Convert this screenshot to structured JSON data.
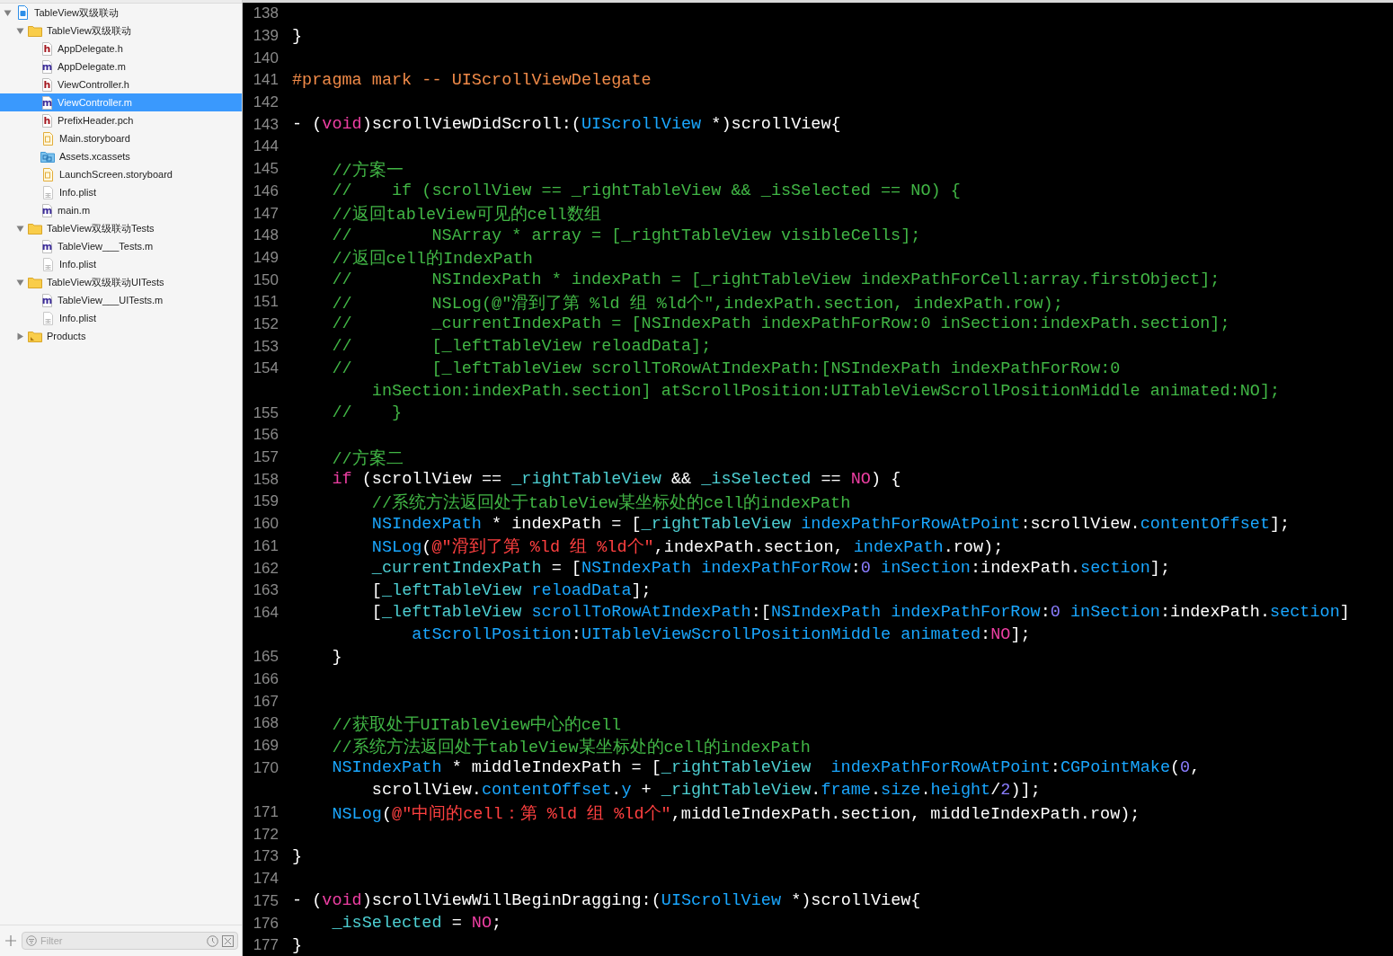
{
  "navigator": {
    "items": [
      {
        "label": "TableView双级联动",
        "kind": "project",
        "expanded": true,
        "selected": false,
        "children": [
          {
            "label": "TableView双级联动",
            "kind": "folder",
            "expanded": true,
            "selected": false,
            "children": [
              {
                "label": "AppDelegate.h",
                "kind": "source",
                "icon_letter": "h",
                "selected": false
              },
              {
                "label": "AppDelegate.m",
                "kind": "source",
                "icon_letter": "m",
                "selected": false
              },
              {
                "label": "ViewController.h",
                "kind": "source",
                "icon_letter": "h",
                "selected": false
              },
              {
                "label": "ViewController.m",
                "kind": "source",
                "icon_letter": "m",
                "selected": true
              },
              {
                "label": "PrefixHeader.pch",
                "kind": "source",
                "icon_letter": "h",
                "selected": false
              },
              {
                "label": "Main.storyboard",
                "kind": "storyboard",
                "selected": false
              },
              {
                "label": "Assets.xcassets",
                "kind": "assets",
                "selected": false
              },
              {
                "label": "LaunchScreen.storyboard",
                "kind": "storyboard",
                "selected": false
              },
              {
                "label": "Info.plist",
                "kind": "plist",
                "selected": false
              },
              {
                "label": "main.m",
                "kind": "source",
                "icon_letter": "m",
                "selected": false
              }
            ]
          },
          {
            "label": "TableView双级联动Tests",
            "kind": "folder",
            "expanded": true,
            "selected": false,
            "children": [
              {
                "label": "TableView___Tests.m",
                "kind": "source",
                "icon_letter": "m",
                "selected": false
              },
              {
                "label": "Info.plist",
                "kind": "plist",
                "selected": false
              }
            ]
          },
          {
            "label": "TableView双级联动UITests",
            "kind": "folder",
            "expanded": true,
            "selected": false,
            "children": [
              {
                "label": "TableView___UITests.m",
                "kind": "source",
                "icon_letter": "m",
                "selected": false
              },
              {
                "label": "Info.plist",
                "kind": "plist",
                "selected": false
              }
            ]
          },
          {
            "label": "Products",
            "kind": "products",
            "expanded": false,
            "selected": false
          }
        ]
      }
    ],
    "filter": {
      "placeholder": "Filter"
    }
  },
  "editor": {
    "lines": [
      {
        "number": "138"
      },
      {
        "number": "139",
        "tokens": [
          {
            "kind": "plain",
            "text": "}"
          }
        ]
      },
      {
        "number": "140"
      },
      {
        "number": "141",
        "tokens": [
          {
            "kind": "preproc",
            "text": "#pragma mark -- UIScrollViewDelegate"
          }
        ]
      },
      {
        "number": "142"
      },
      {
        "number": "143",
        "tokens": [
          {
            "kind": "plain",
            "text": "- ("
          },
          {
            "kind": "keyword",
            "text": "void"
          },
          {
            "kind": "plain",
            "text": ")scrollViewDidScroll:("
          },
          {
            "kind": "type",
            "text": "UIScrollView"
          },
          {
            "kind": "plain",
            "text": " *)scrollView{"
          }
        ]
      },
      {
        "number": "144"
      },
      {
        "number": "145",
        "tokens": [
          {
            "kind": "comment",
            "text": "    //方案一"
          }
        ]
      },
      {
        "number": "146",
        "tokens": [
          {
            "kind": "comment",
            "text": "    //    if (scrollView == _rightTableView && _isSelected == NO) {"
          }
        ]
      },
      {
        "number": "147",
        "tokens": [
          {
            "kind": "comment",
            "text": "    //返回tableView可见的cell数组"
          }
        ]
      },
      {
        "number": "148",
        "tokens": [
          {
            "kind": "comment",
            "text": "    //        NSArray * array = [_rightTableView visibleCells];"
          }
        ]
      },
      {
        "number": "149",
        "tokens": [
          {
            "kind": "comment",
            "text": "    //返回cell的IndexPath"
          }
        ]
      },
      {
        "number": "150",
        "tokens": [
          {
            "kind": "comment",
            "text": "    //        NSIndexPath * indexPath = [_rightTableView indexPathForCell:array.firstObject];"
          }
        ]
      },
      {
        "number": "151",
        "tokens": [
          {
            "kind": "comment",
            "text": "    //        NSLog(@\"滑到了第 %ld 组 %ld个\",indexPath.section, indexPath.row);"
          }
        ]
      },
      {
        "number": "152",
        "tokens": [
          {
            "kind": "comment",
            "text": "    //        _currentIndexPath = [NSIndexPath indexPathForRow:0 inSection:indexPath.section];"
          }
        ]
      },
      {
        "number": "153",
        "tokens": [
          {
            "kind": "comment",
            "text": "    //        [_leftTableView reloadData];"
          }
        ]
      },
      {
        "number": "154",
        "tokens": [
          {
            "kind": "comment",
            "text": "    //        [_leftTableView scrollToRowAtIndexPath:[NSIndexPath indexPathForRow:0"
          }
        ],
        "wrapped_tokens": [
          {
            "kind": "comment",
            "text": "        inSection:indexPath.section] atScrollPosition:UITableViewScrollPositionMiddle animated:NO];"
          }
        ]
      },
      {
        "number": "155",
        "tokens": [
          {
            "kind": "comment",
            "text": "    //    }"
          }
        ]
      },
      {
        "number": "156"
      },
      {
        "number": "157",
        "tokens": [
          {
            "kind": "comment",
            "text": "    //方案二"
          }
        ]
      },
      {
        "number": "158",
        "tokens": [
          {
            "kind": "keyword",
            "text": "    if"
          },
          {
            "kind": "plain",
            "text": " (scrollView == "
          },
          {
            "kind": "ivar",
            "text": "_rightTableView"
          },
          {
            "kind": "plain",
            "text": " && "
          },
          {
            "kind": "ivar",
            "text": "_isSelected"
          },
          {
            "kind": "plain",
            "text": " == "
          },
          {
            "kind": "keyword",
            "text": "NO"
          },
          {
            "kind": "plain",
            "text": ") {"
          }
        ]
      },
      {
        "number": "159",
        "tokens": [
          {
            "kind": "comment",
            "text": "        //系统方法返回处于tableView某坐标处的cell的indexPath"
          }
        ]
      },
      {
        "number": "160",
        "tokens": [
          {
            "kind": "type",
            "text": "        NSIndexPath"
          },
          {
            "kind": "plain",
            "text": " * indexPath = ["
          },
          {
            "kind": "ivar",
            "text": "_rightTableView"
          },
          {
            "kind": "method",
            "text": " indexPathForRowAtPoint"
          },
          {
            "kind": "plain",
            "text": ":scrollView."
          },
          {
            "kind": "method",
            "text": "contentOffset"
          },
          {
            "kind": "plain",
            "text": "];"
          }
        ]
      },
      {
        "number": "161",
        "tokens": [
          {
            "kind": "type",
            "text": "        NSLog"
          },
          {
            "kind": "plain",
            "text": "("
          },
          {
            "kind": "string",
            "text": "@\"滑到了第 %ld 组 %ld个\""
          },
          {
            "kind": "plain",
            "text": ",indexPath.section, "
          },
          {
            "kind": "method",
            "text": "indexPath"
          },
          {
            "kind": "plain",
            "text": ".row);"
          }
        ]
      },
      {
        "number": "162",
        "tokens": [
          {
            "kind": "ivar",
            "text": "        _currentIndexPath"
          },
          {
            "kind": "plain",
            "text": " = ["
          },
          {
            "kind": "type",
            "text": "NSIndexPath"
          },
          {
            "kind": "method",
            "text": " indexPathForRow"
          },
          {
            "kind": "plain",
            "text": ":"
          },
          {
            "kind": "number",
            "text": "0"
          },
          {
            "kind": "method",
            "text": " inSection"
          },
          {
            "kind": "plain",
            "text": ":indexPath."
          },
          {
            "kind": "method",
            "text": "section"
          },
          {
            "kind": "plain",
            "text": "];"
          }
        ]
      },
      {
        "number": "163",
        "tokens": [
          {
            "kind": "plain",
            "text": "        ["
          },
          {
            "kind": "ivar",
            "text": "_leftTableView"
          },
          {
            "kind": "method",
            "text": " reloadData"
          },
          {
            "kind": "plain",
            "text": "];"
          }
        ]
      },
      {
        "number": "164",
        "tokens": [
          {
            "kind": "plain",
            "text": "        ["
          },
          {
            "kind": "ivar",
            "text": "_leftTableView"
          },
          {
            "kind": "method",
            "text": " scrollToRowAtIndexPath"
          },
          {
            "kind": "plain",
            "text": ":["
          },
          {
            "kind": "type",
            "text": "NSIndexPath"
          },
          {
            "kind": "method",
            "text": " indexPathForRow"
          },
          {
            "kind": "plain",
            "text": ":"
          },
          {
            "kind": "number",
            "text": "0"
          },
          {
            "kind": "method",
            "text": " inSection"
          },
          {
            "kind": "plain",
            "text": ":indexPath."
          },
          {
            "kind": "method",
            "text": "section"
          },
          {
            "kind": "plain",
            "text": "]"
          }
        ],
        "wrapped_tokens": [
          {
            "kind": "method",
            "text": "            atScrollPosition"
          },
          {
            "kind": "plain",
            "text": ":"
          },
          {
            "kind": "type",
            "text": "UITableViewScrollPositionMiddle"
          },
          {
            "kind": "method",
            "text": " animated"
          },
          {
            "kind": "plain",
            "text": ":"
          },
          {
            "kind": "keyword",
            "text": "NO"
          },
          {
            "kind": "plain",
            "text": "];"
          }
        ]
      },
      {
        "number": "165",
        "tokens": [
          {
            "kind": "plain",
            "text": "    }"
          }
        ]
      },
      {
        "number": "166"
      },
      {
        "number": "167"
      },
      {
        "number": "168",
        "tokens": [
          {
            "kind": "comment",
            "text": "    //获取处于UITableView中心的cell"
          }
        ]
      },
      {
        "number": "169",
        "tokens": [
          {
            "kind": "comment",
            "text": "    //系统方法返回处于tableView某坐标处的cell的indexPath"
          }
        ]
      },
      {
        "number": "170",
        "tokens": [
          {
            "kind": "type",
            "text": "    NSIndexPath"
          },
          {
            "kind": "plain",
            "text": " * middleIndexPath = ["
          },
          {
            "kind": "ivar",
            "text": "_rightTableView"
          },
          {
            "kind": "method",
            "text": "  indexPathForRowAtPoint"
          },
          {
            "kind": "plain",
            "text": ":"
          },
          {
            "kind": "type",
            "text": "CGPointMake"
          },
          {
            "kind": "plain",
            "text": "("
          },
          {
            "kind": "number",
            "text": "0"
          },
          {
            "kind": "plain",
            "text": ","
          }
        ],
        "wrapped_tokens": [
          {
            "kind": "plain",
            "text": "        scrollView."
          },
          {
            "kind": "method",
            "text": "contentOffset"
          },
          {
            "kind": "plain",
            "text": "."
          },
          {
            "kind": "method",
            "text": "y"
          },
          {
            "kind": "plain",
            "text": " + "
          },
          {
            "kind": "ivar",
            "text": "_rightTableView"
          },
          {
            "kind": "plain",
            "text": "."
          },
          {
            "kind": "method",
            "text": "frame"
          },
          {
            "kind": "plain",
            "text": "."
          },
          {
            "kind": "method",
            "text": "size"
          },
          {
            "kind": "plain",
            "text": "."
          },
          {
            "kind": "method",
            "text": "height"
          },
          {
            "kind": "plain",
            "text": "/"
          },
          {
            "kind": "number",
            "text": "2"
          },
          {
            "kind": "plain",
            "text": ")];"
          }
        ]
      },
      {
        "number": "171",
        "tokens": [
          {
            "kind": "type",
            "text": "    NSLog"
          },
          {
            "kind": "plain",
            "text": "("
          },
          {
            "kind": "string",
            "text": "@\"中间的cell：第 %ld 组 %ld个\""
          },
          {
            "kind": "plain",
            "text": ",middleIndexPath.section, middleIndexPath.row);"
          }
        ]
      },
      {
        "number": "172"
      },
      {
        "number": "173",
        "tokens": [
          {
            "kind": "plain",
            "text": "}"
          }
        ]
      },
      {
        "number": "174"
      },
      {
        "number": "175",
        "tokens": [
          {
            "kind": "plain",
            "text": "- ("
          },
          {
            "kind": "keyword",
            "text": "void"
          },
          {
            "kind": "plain",
            "text": ")scrollViewWillBeginDragging:("
          },
          {
            "kind": "type",
            "text": "UIScrollView"
          },
          {
            "kind": "plain",
            "text": " *)scrollView{"
          }
        ]
      },
      {
        "number": "176",
        "tokens": [
          {
            "kind": "ivar",
            "text": "    _isSelected"
          },
          {
            "kind": "plain",
            "text": " = "
          },
          {
            "kind": "keyword",
            "text": "NO"
          },
          {
            "kind": "plain",
            "text": ";"
          }
        ]
      },
      {
        "number": "177",
        "tokens": [
          {
            "kind": "plain",
            "text": "}"
          }
        ]
      }
    ]
  }
}
